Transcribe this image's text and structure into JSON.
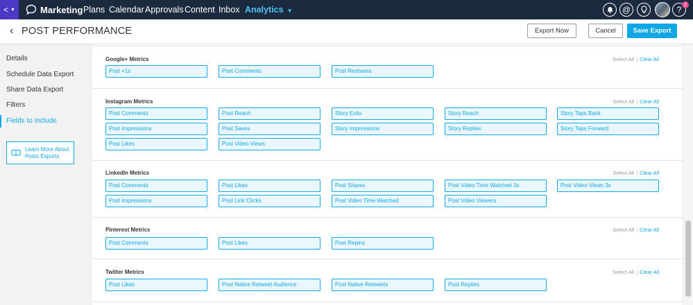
{
  "nav": {
    "brand": "Marketing",
    "links": [
      "Plans",
      "Calendar",
      "Approvals",
      "Content",
      "Inbox"
    ],
    "active_link": "Analytics",
    "badge_count": "2"
  },
  "header": {
    "title": "POST PERFORMANCE",
    "export_now": "Export Now",
    "cancel": "Cancel",
    "save_export": "Save Export"
  },
  "sidebar": {
    "items": [
      "Details",
      "Schedule Data Export",
      "Share Data Export",
      "Filters",
      "Fields to Include"
    ],
    "learn_line1": "Learn More About",
    "learn_line2": "Posts Exports"
  },
  "sections": [
    {
      "title": "Google+ Metrics",
      "select_all": "Select All",
      "clear_all": "Clear All",
      "fields": [
        "Post +1s",
        "Post Comments",
        "Post Reshares"
      ]
    },
    {
      "title": "Instagram Metrics",
      "select_all": "Select All",
      "clear_all": "Clear All",
      "fields": [
        "Post Comments",
        "Post Reach",
        "Story Exits",
        "Story Reach",
        "Story Taps Back",
        "Post Impressions",
        "Post Saves",
        "Story Impressions",
        "Story Replies",
        "Story Taps Forward",
        "Post Likes",
        "Post Video Views"
      ]
    },
    {
      "title": "LinkedIn Metrics",
      "select_all": "Select All",
      "clear_all": "Clear All",
      "fields": [
        "Post Comments",
        "Post Likes",
        "Post Shares",
        "Post Video Time Watched 3s",
        "Post Video Views 3s",
        "Post Impressions",
        "Post Link Clicks",
        "Post Video Time Watched",
        "Post Video Viewers"
      ]
    },
    {
      "title": "Pinterest Metrics",
      "select_all": "Select All",
      "clear_all": "Clear All",
      "fields": [
        "Post Comments",
        "Post Likes",
        "Post Repins"
      ]
    },
    {
      "title": "Twitter Metrics",
      "select_all": "Select All",
      "clear_all": "Clear All",
      "fields": [
        "Post Likes",
        "Post Native Retweet Audience",
        "Post Native Retweets",
        "Post Replies"
      ]
    }
  ]
}
